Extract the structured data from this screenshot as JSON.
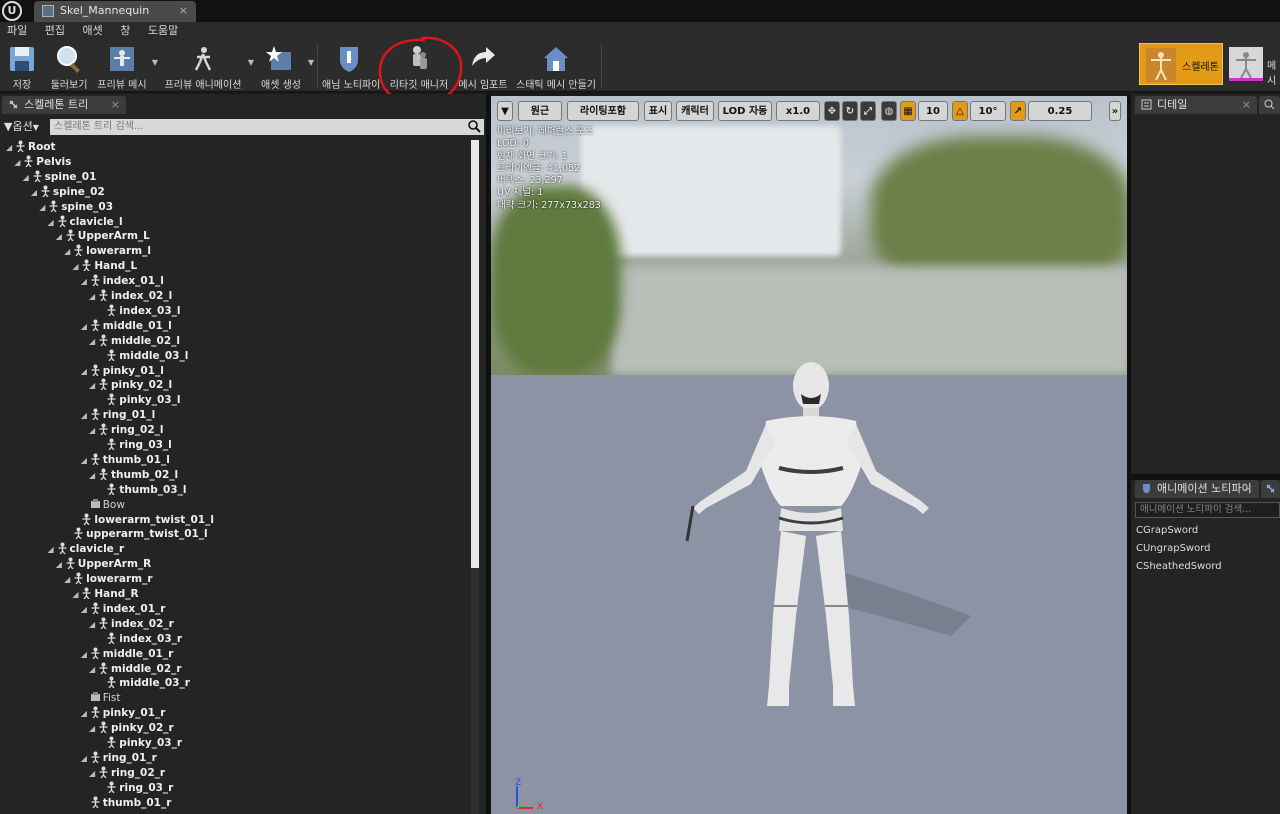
{
  "titlebar": {
    "logo": "U",
    "tab_title": "Skel_Mannequin",
    "tab_close": "×"
  },
  "menu": [
    "파일",
    "편집",
    "애셋",
    "창",
    "도움말"
  ],
  "toolbar": {
    "save": "저장",
    "browse": "둘러보기",
    "preview_mesh": "프리뷰 메시",
    "preview_anim": "프리뷰 애니메이션",
    "create_asset": "애셋 생성",
    "anim_notify": "애님 노티파이",
    "retarget_manager": "리타깃 매니저",
    "import_mesh": "메시 임포트",
    "make_static_mesh": "스태틱 메시 만들기",
    "mode_skeleton": "스켈레톤",
    "mode_mesh": "메시"
  },
  "skeleton_tree": {
    "tab_label": "스켈레톤 트리",
    "tab_close": "×",
    "options_label": "옵션",
    "search_placeholder": "스켈레톤 트리 검색...",
    "rows": [
      {
        "label": "Root",
        "depth": 0,
        "kind": "bone"
      },
      {
        "label": "Pelvis",
        "depth": 1,
        "kind": "bone"
      },
      {
        "label": "spine_01",
        "depth": 2,
        "kind": "bone"
      },
      {
        "label": "spine_02",
        "depth": 3,
        "kind": "bone"
      },
      {
        "label": "spine_03",
        "depth": 4,
        "kind": "bone"
      },
      {
        "label": "clavicle_l",
        "depth": 5,
        "kind": "bone"
      },
      {
        "label": "UpperArm_L",
        "depth": 6,
        "kind": "bone"
      },
      {
        "label": "lowerarm_l",
        "depth": 7,
        "kind": "bone"
      },
      {
        "label": "Hand_L",
        "depth": 8,
        "kind": "bone"
      },
      {
        "label": "index_01_l",
        "depth": 9,
        "kind": "bone"
      },
      {
        "label": "index_02_l",
        "depth": 10,
        "kind": "bone"
      },
      {
        "label": "index_03_l",
        "depth": 11,
        "kind": "bone"
      },
      {
        "label": "middle_01_l",
        "depth": 9,
        "kind": "bone"
      },
      {
        "label": "middle_02_l",
        "depth": 10,
        "kind": "bone"
      },
      {
        "label": "middle_03_l",
        "depth": 11,
        "kind": "bone"
      },
      {
        "label": "pinky_01_l",
        "depth": 9,
        "kind": "bone"
      },
      {
        "label": "pinky_02_l",
        "depth": 10,
        "kind": "bone"
      },
      {
        "label": "pinky_03_l",
        "depth": 11,
        "kind": "bone"
      },
      {
        "label": "ring_01_l",
        "depth": 9,
        "kind": "bone"
      },
      {
        "label": "ring_02_l",
        "depth": 10,
        "kind": "bone"
      },
      {
        "label": "ring_03_l",
        "depth": 11,
        "kind": "bone"
      },
      {
        "label": "thumb_01_l",
        "depth": 9,
        "kind": "bone"
      },
      {
        "label": "thumb_02_l",
        "depth": 10,
        "kind": "bone"
      },
      {
        "label": "thumb_03_l",
        "depth": 11,
        "kind": "bone"
      },
      {
        "label": "Bow",
        "depth": 9,
        "kind": "socket"
      },
      {
        "label": "lowerarm_twist_01_l",
        "depth": 8,
        "kind": "bone"
      },
      {
        "label": "upperarm_twist_01_l",
        "depth": 7,
        "kind": "bone"
      },
      {
        "label": "clavicle_r",
        "depth": 5,
        "kind": "bone"
      },
      {
        "label": "UpperArm_R",
        "depth": 6,
        "kind": "bone"
      },
      {
        "label": "lowerarm_r",
        "depth": 7,
        "kind": "bone"
      },
      {
        "label": "Hand_R",
        "depth": 8,
        "kind": "bone"
      },
      {
        "label": "index_01_r",
        "depth": 9,
        "kind": "bone"
      },
      {
        "label": "index_02_r",
        "depth": 10,
        "kind": "bone"
      },
      {
        "label": "index_03_r",
        "depth": 11,
        "kind": "bone"
      },
      {
        "label": "middle_01_r",
        "depth": 9,
        "kind": "bone"
      },
      {
        "label": "middle_02_r",
        "depth": 10,
        "kind": "bone"
      },
      {
        "label": "middle_03_r",
        "depth": 11,
        "kind": "bone"
      },
      {
        "label": "Fist",
        "depth": 9,
        "kind": "socket"
      },
      {
        "label": "pinky_01_r",
        "depth": 9,
        "kind": "bone"
      },
      {
        "label": "pinky_02_r",
        "depth": 10,
        "kind": "bone"
      },
      {
        "label": "pinky_03_r",
        "depth": 11,
        "kind": "bone"
      },
      {
        "label": "ring_01_r",
        "depth": 9,
        "kind": "bone"
      },
      {
        "label": "ring_02_r",
        "depth": 10,
        "kind": "bone"
      },
      {
        "label": "ring_03_r",
        "depth": 11,
        "kind": "bone"
      },
      {
        "label": "thumb_01_r",
        "depth": 9,
        "kind": "bone"
      }
    ]
  },
  "viewport": {
    "perspective": "원근",
    "lighting": "라이팅포함",
    "show": "표시",
    "character": "캐릭터",
    "lod": "LOD 자동",
    "speed": "x1.0",
    "grid_value": "10",
    "angle_value": "10°",
    "scale_value": "0.25",
    "info": [
      "미리보기: 레퍼런스 포즈",
      "LOD: 0",
      "현재 화면 크기: 1",
      "트라이앵글: 41,052",
      "버텍스: 23,297",
      "UV 채널: 1",
      "대략 크기: 277x73x283"
    ],
    "axis_z": "Z",
    "axis_x": "X"
  },
  "details": {
    "tab_label": "디테일",
    "tab_close": "×"
  },
  "anim_notifies": {
    "tab_label": "애니메이션 노티파이",
    "tab_close": "×",
    "search_placeholder": "애니메이션 노티파이 검색...",
    "items": [
      "CGrapSword",
      "CUngrapSword",
      "CSheathedSword"
    ]
  },
  "colors": {
    "accent_orange": "#e39b17",
    "highlight_red": "#e0141b"
  }
}
